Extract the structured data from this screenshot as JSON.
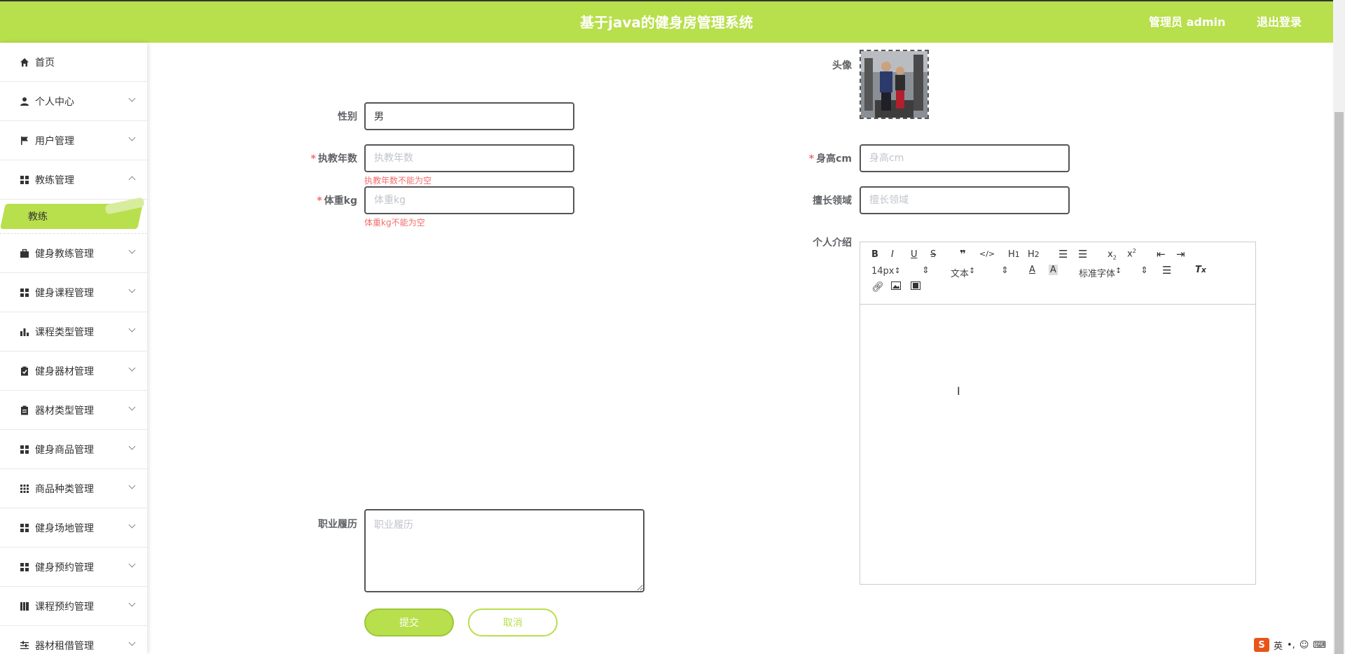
{
  "header": {
    "title": "基于java的健身房管理系统",
    "user_label": "管理员 admin",
    "logout_label": "退出登录"
  },
  "sidebar": {
    "items": [
      {
        "label": "首页",
        "icon": "home-icon"
      },
      {
        "label": "个人中心",
        "icon": "user-icon"
      },
      {
        "label": "用户管理",
        "icon": "flag-icon"
      },
      {
        "label": "教练管理",
        "icon": "grid-icon"
      },
      {
        "label": "健身教练管理",
        "icon": "briefcase-icon"
      },
      {
        "label": "健身课程管理",
        "icon": "grid-icon"
      },
      {
        "label": "课程类型管理",
        "icon": "bar-chart-icon"
      },
      {
        "label": "健身器材管理",
        "icon": "clipboard-check-icon"
      },
      {
        "label": "器材类型管理",
        "icon": "clipboard-icon"
      },
      {
        "label": "健身商品管理",
        "icon": "grid-icon"
      },
      {
        "label": "商品种类管理",
        "icon": "apps-icon"
      },
      {
        "label": "健身场地管理",
        "icon": "grid-icon"
      },
      {
        "label": "健身预约管理",
        "icon": "grid-icon"
      },
      {
        "label": "课程预约管理",
        "icon": "book-icon"
      },
      {
        "label": "器材租借管理",
        "icon": "sliders-icon"
      }
    ],
    "active_sub": "教练"
  },
  "form": {
    "avatar_label": "头像",
    "gender_label": "性别",
    "gender_value": "男",
    "years_label": "执教年数",
    "years_placeholder": "执教年数",
    "years_error": "执教年数不能为空",
    "height_label": "身高cm",
    "height_placeholder": "身高cm",
    "weight_label": "体重kg",
    "weight_placeholder": "体重kg",
    "weight_error": "体重kg不能为空",
    "specialty_label": "擅长领域",
    "specialty_placeholder": "擅长领域",
    "intro_label": "个人介绍",
    "resume_label": "职业履历",
    "resume_placeholder": "职业履历",
    "required_mark": "*",
    "submit_label": "提交",
    "cancel_label": "取消"
  },
  "editor": {
    "font_size": "14px",
    "header_select": "文本",
    "font_family": "标准字体"
  },
  "ime": {
    "logo": "S",
    "lang": "英"
  },
  "colors": {
    "accent": "#b8df4c",
    "error": "#f56c6c"
  }
}
